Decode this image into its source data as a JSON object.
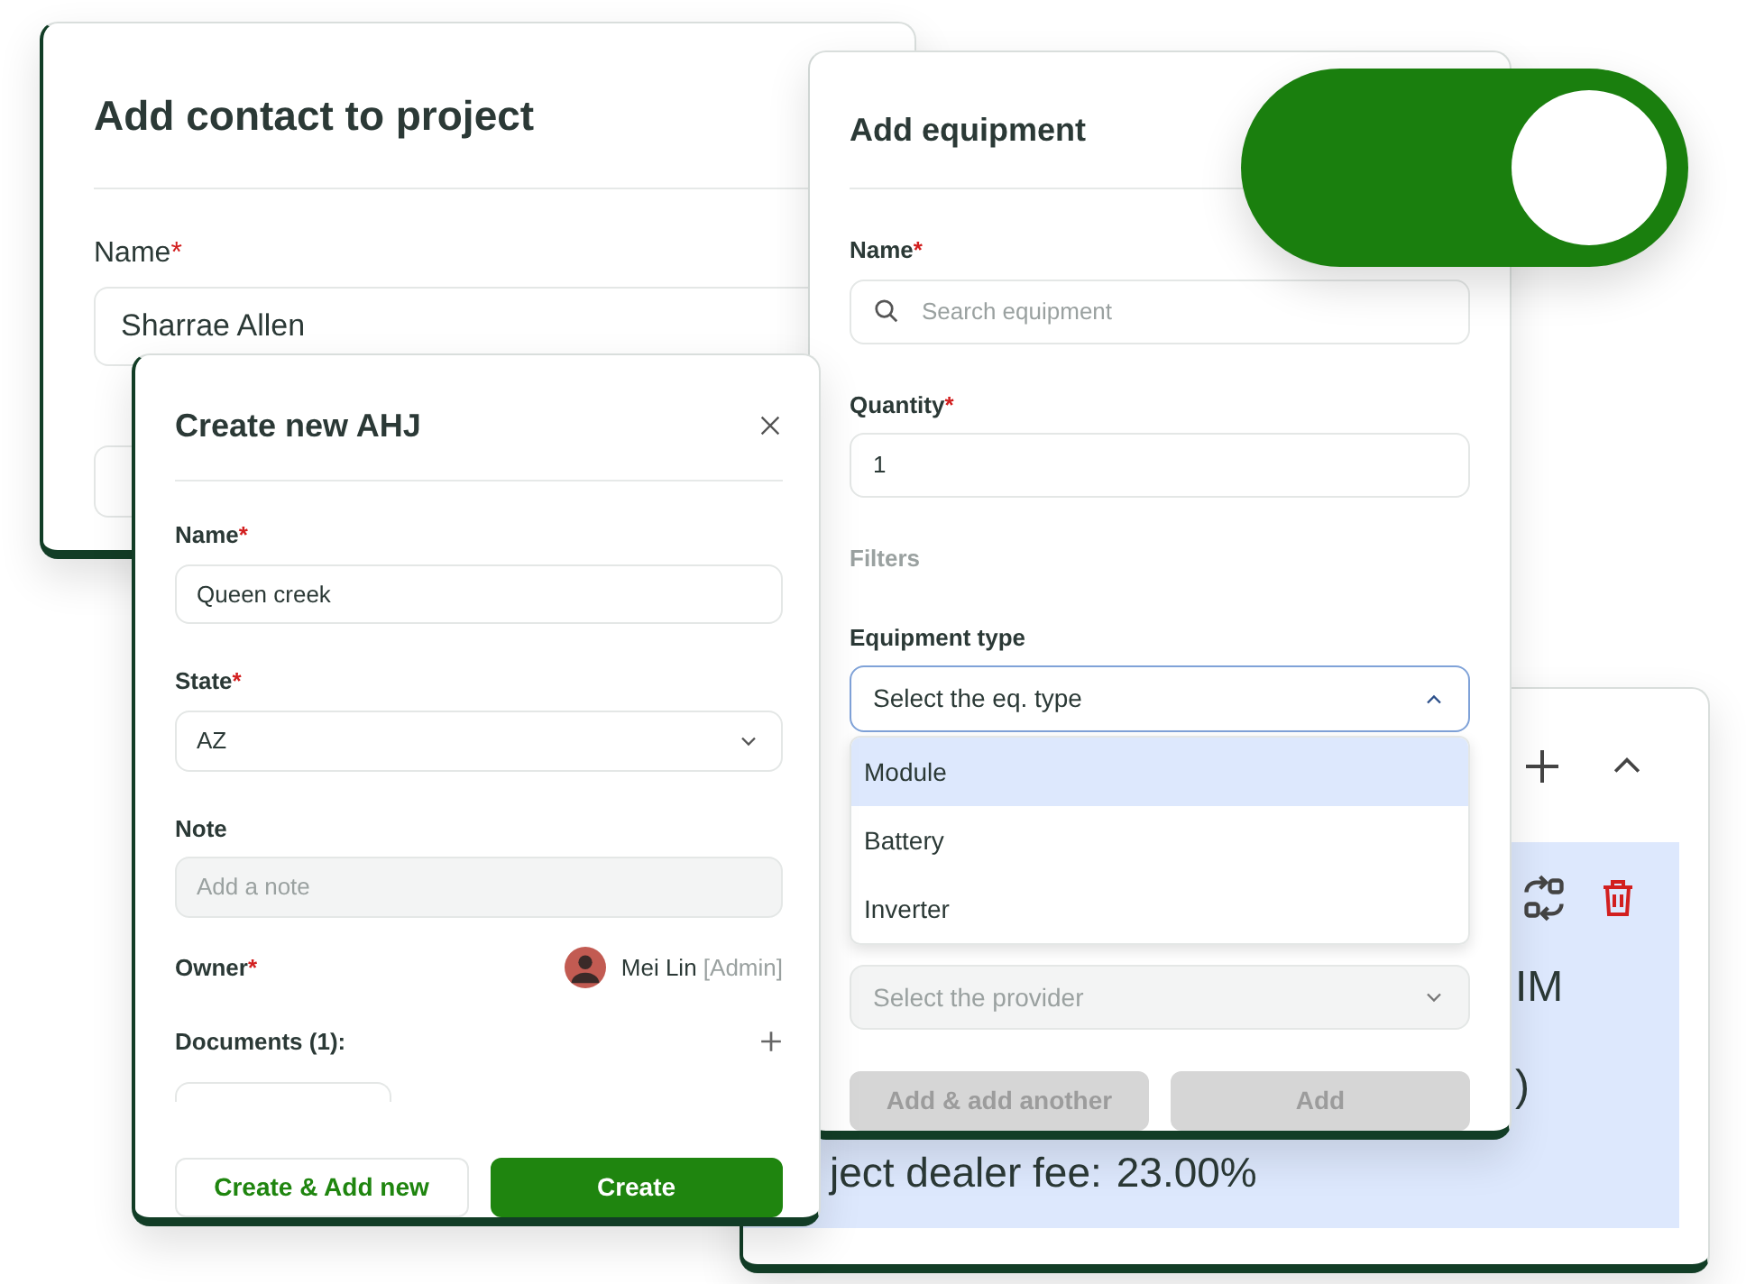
{
  "contact_card": {
    "title": "Add contact to project",
    "name_field": {
      "label": "Name",
      "required_mark": "*",
      "value": "Sharrae Allen"
    }
  },
  "detail_card": {
    "fragments": [
      "IM",
      ")"
    ],
    "fee_label": "ject dealer fee:",
    "fee_value": "23.00%"
  },
  "equipment_card": {
    "title": "Add equipment",
    "name_field": {
      "label": "Name",
      "required_mark": "*",
      "placeholder": "Search equipment"
    },
    "quantity_field": {
      "label": "Quantity",
      "required_mark": "*",
      "value": "1"
    },
    "filters_label": "Filters",
    "type_field": {
      "label": "Equipment type",
      "placeholder": "Select the eq. type",
      "expanded": true,
      "options": [
        {
          "label": "Module",
          "selected": true
        },
        {
          "label": "Battery",
          "selected": false
        },
        {
          "label": "Inverter",
          "selected": false
        }
      ]
    },
    "provider_field": {
      "placeholder": "Select the provider",
      "disabled": true
    },
    "buttons": [
      {
        "label": "Add & add another",
        "disabled": true
      },
      {
        "label": "Add",
        "disabled": true
      }
    ]
  },
  "ahj_card": {
    "title": "Create new AHJ",
    "fields": [
      {
        "kind": "text",
        "label": "Name",
        "required_mark": "*",
        "value": "Queen creek"
      },
      {
        "kind": "select",
        "label": "State",
        "required_mark": "*",
        "value": "AZ"
      },
      {
        "kind": "textarea",
        "label": "Note",
        "placeholder": "Add a note"
      }
    ],
    "owner": {
      "label": "Owner",
      "required_mark": "*",
      "name": "Mei Lin",
      "role": "[Admin]"
    },
    "documents_label": "Documents (1):",
    "buttons": [
      {
        "label": "Create & Add new",
        "kind": "secondary"
      },
      {
        "label": "Create",
        "kind": "primary"
      }
    ]
  },
  "toggle": {
    "on": true
  }
}
